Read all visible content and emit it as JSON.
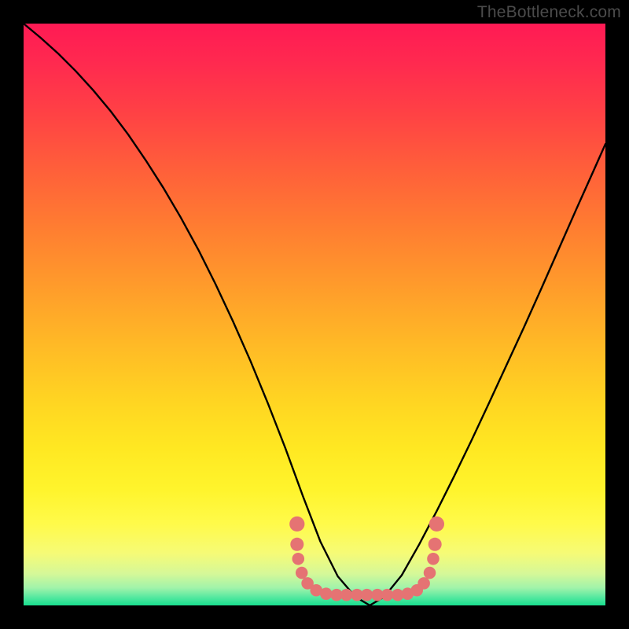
{
  "watermark": "TheBottleneck.com",
  "chart_data": {
    "type": "line",
    "title": "",
    "xlabel": "",
    "ylabel": "",
    "xlim": [
      0,
      100
    ],
    "ylim": [
      0,
      100
    ],
    "gradient_stops": [
      {
        "offset": 0.0,
        "color": "#ff1a54"
      },
      {
        "offset": 0.07,
        "color": "#ff2a4f"
      },
      {
        "offset": 0.15,
        "color": "#ff4045"
      },
      {
        "offset": 0.25,
        "color": "#ff5f3a"
      },
      {
        "offset": 0.35,
        "color": "#ff7d31"
      },
      {
        "offset": 0.45,
        "color": "#ff9b2b"
      },
      {
        "offset": 0.55,
        "color": "#ffb926"
      },
      {
        "offset": 0.65,
        "color": "#ffd522"
      },
      {
        "offset": 0.73,
        "color": "#ffe822"
      },
      {
        "offset": 0.8,
        "color": "#fff42c"
      },
      {
        "offset": 0.86,
        "color": "#fffa4a"
      },
      {
        "offset": 0.91,
        "color": "#f6fb76"
      },
      {
        "offset": 0.945,
        "color": "#d6f898"
      },
      {
        "offset": 0.97,
        "color": "#a0f3aa"
      },
      {
        "offset": 0.985,
        "color": "#5ae9a1"
      },
      {
        "offset": 1.0,
        "color": "#18df8f"
      }
    ],
    "series": [
      {
        "name": "bottleneck-curve",
        "x": [
          0,
          3,
          6,
          9,
          12,
          15,
          18,
          21,
          24,
          27,
          30,
          33,
          36,
          39,
          42,
          45,
          48,
          51,
          54,
          57,
          59.5,
          62,
          65,
          68,
          71,
          74,
          77,
          80,
          83,
          86,
          89,
          92,
          95,
          98,
          100
        ],
        "y": [
          100.0,
          97.5,
          94.8,
          91.8,
          88.5,
          84.9,
          80.9,
          76.5,
          71.8,
          66.7,
          61.2,
          55.2,
          48.8,
          42.0,
          34.7,
          27.0,
          18.8,
          11.0,
          5.0,
          1.5,
          0.0,
          1.5,
          5.2,
          10.5,
          16.2,
          22.2,
          28.4,
          34.8,
          41.3,
          47.8,
          54.5,
          61.3,
          68.1,
          74.8,
          79.3
        ]
      }
    ],
    "flat_region": [
      47,
      71
    ],
    "dots": {
      "name": "marker-dots",
      "color": "#e57373",
      "points": [
        {
          "x": 47.0,
          "y": 14.0,
          "r": 1.3
        },
        {
          "x": 47.0,
          "y": 10.5,
          "r": 1.15
        },
        {
          "x": 47.2,
          "y": 8.0,
          "r": 1.05
        },
        {
          "x": 47.8,
          "y": 5.6,
          "r": 1.05
        },
        {
          "x": 48.8,
          "y": 3.8,
          "r": 1.05
        },
        {
          "x": 50.3,
          "y": 2.6,
          "r": 1.05
        },
        {
          "x": 52.0,
          "y": 2.0,
          "r": 1.05
        },
        {
          "x": 53.8,
          "y": 1.8,
          "r": 1.05
        },
        {
          "x": 55.5,
          "y": 1.8,
          "r": 1.05
        },
        {
          "x": 57.3,
          "y": 1.8,
          "r": 1.05
        },
        {
          "x": 59.0,
          "y": 1.8,
          "r": 1.05
        },
        {
          "x": 60.8,
          "y": 1.8,
          "r": 1.05
        },
        {
          "x": 62.5,
          "y": 1.8,
          "r": 1.05
        },
        {
          "x": 64.3,
          "y": 1.8,
          "r": 1.05
        },
        {
          "x": 66.0,
          "y": 2.0,
          "r": 1.05
        },
        {
          "x": 67.6,
          "y": 2.6,
          "r": 1.05
        },
        {
          "x": 68.8,
          "y": 3.8,
          "r": 1.05
        },
        {
          "x": 69.8,
          "y": 5.6,
          "r": 1.05
        },
        {
          "x": 70.4,
          "y": 8.0,
          "r": 1.05
        },
        {
          "x": 70.7,
          "y": 10.5,
          "r": 1.15
        },
        {
          "x": 71.0,
          "y": 14.0,
          "r": 1.3
        }
      ]
    }
  }
}
